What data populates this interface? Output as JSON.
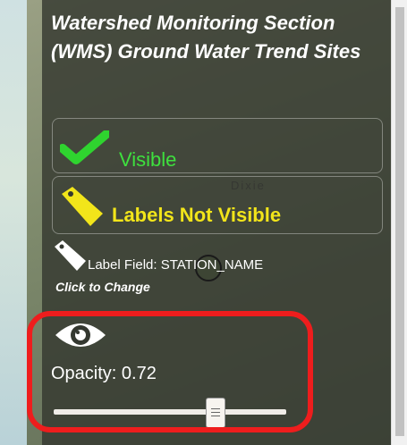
{
  "layer": {
    "title": "Watershed Monitoring Section (WMS) Ground Water Trend Sites",
    "visibility_label": "Visible",
    "labels_label": "Labels Not Visible",
    "label_field_text": "Label Field: STATION_NAME",
    "click_to_change": "Click to Change",
    "opacity_text": "Opacity: 0.72",
    "opacity_value": 0.72
  },
  "map": {
    "place_label": "Dixie"
  },
  "colors": {
    "visible": "#3ee03e",
    "labels": "#f2e51a",
    "highlight": "#ee1d1d"
  },
  "icons": [
    "check-icon",
    "tag-icon",
    "tag-white-icon",
    "eye-icon"
  ]
}
